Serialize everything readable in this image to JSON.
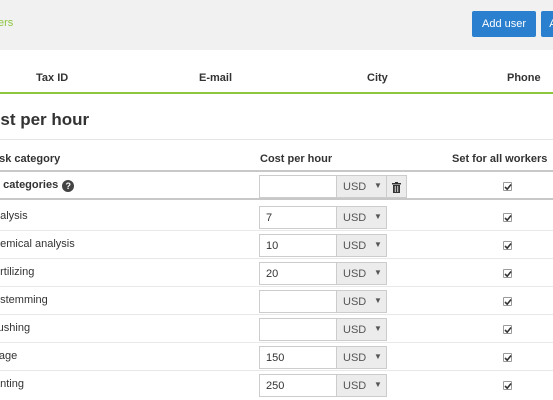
{
  "header": {
    "breadcrumb": "ers",
    "add_user_label": "Add user",
    "second_button_label": "Ad"
  },
  "columns": [
    "Tax ID",
    "E-mail",
    "City",
    "Phone"
  ],
  "section": {
    "title": "ost per hour"
  },
  "table": {
    "headers": {
      "task_category": "ask category",
      "cost_per_hour": "Cost per hour",
      "set_for_all": "Set for all workers"
    },
    "all_row": {
      "label": "ll categories",
      "value": "",
      "currency": "USD",
      "checked": true
    },
    "rows": [
      {
        "label": "nalysis",
        "value": "7",
        "currency": "USD",
        "checked": true
      },
      {
        "label": "hemical analysis",
        "value": "10",
        "currency": "USD",
        "checked": true
      },
      {
        "label": "ertilizing",
        "value": "20",
        "currency": "USD",
        "checked": true
      },
      {
        "label": "estemming",
        "value": "",
        "currency": "USD",
        "checked": true
      },
      {
        "label": "rushing",
        "value": "",
        "currency": "USD",
        "checked": true
      },
      {
        "label": "llage",
        "value": "150",
        "currency": "USD",
        "checked": true
      },
      {
        "label": "anting",
        "value": "250",
        "currency": "USD",
        "checked": true
      }
    ]
  },
  "icons": {
    "help": "question-circle-icon",
    "trash": "trash-icon",
    "caret": "caret-down-icon",
    "check": "checkmark-icon"
  },
  "colors": {
    "accent_green": "#8dc63f",
    "button_blue": "#2a7fce",
    "topbar_bg": "#f1f1f1"
  }
}
